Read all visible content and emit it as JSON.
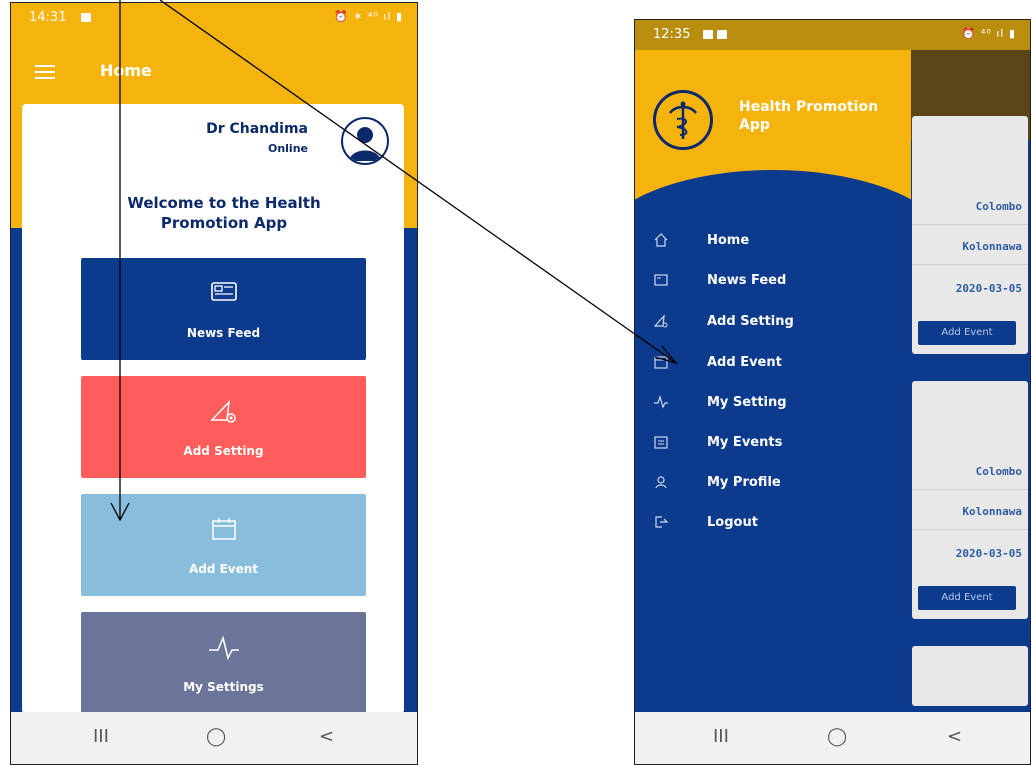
{
  "left_screen": {
    "status": {
      "time": "14:31",
      "sys_icons": "⏰ ✶ ⁴⁰ ıl ▮"
    },
    "header": {
      "title": "Home"
    },
    "user": {
      "name": "Dr Chandima",
      "status": "Online"
    },
    "welcome": "Welcome to the Health Promotion App",
    "tiles": [
      {
        "label": "News Feed",
        "icon": "newspaper-icon",
        "color": "#0c3a8c"
      },
      {
        "label": "Add Setting",
        "icon": "settings-plane-icon",
        "color": "#ff5c5c"
      },
      {
        "label": "Add Event",
        "icon": "calendar-icon",
        "color": "#88bddb"
      },
      {
        "label": "My Settings",
        "icon": "pulse-icon",
        "color": "#6b7499"
      }
    ],
    "nav": {
      "recents": "III",
      "home": "◯",
      "back": "<"
    }
  },
  "right_screen": {
    "status": {
      "time": "12:35",
      "sys_icons": "⏰ ⁴⁰ ıl ▮"
    },
    "drawer": {
      "app_title": "Health Promotion App",
      "items": [
        {
          "label": "Home",
          "icon": "home-icon"
        },
        {
          "label": "News Feed",
          "icon": "newspaper-icon"
        },
        {
          "label": "Add Setting",
          "icon": "settings-plane-icon"
        },
        {
          "label": "Add Event",
          "icon": "calendar-icon"
        },
        {
          "label": "My Setting",
          "icon": "pulse-icon"
        },
        {
          "label": "My Events",
          "icon": "calendar-grid-icon"
        },
        {
          "label": "My Profile",
          "icon": "person-icon"
        },
        {
          "label": "Logout",
          "icon": "logout-icon"
        }
      ]
    },
    "events": [
      {
        "district": "Colombo",
        "area": "Kolonnawa",
        "date": "2020-03-05",
        "button": "Add Event"
      },
      {
        "district": "Colombo",
        "area": "Kolonnawa",
        "date": "2020-03-05",
        "button": "Add Event"
      }
    ],
    "nav": {
      "recents": "III",
      "home": "◯",
      "back": "<"
    }
  },
  "colors": {
    "yellow": "#f5b40d",
    "navy": "#0c3a8c",
    "coral": "#ff5c5c",
    "light_blue": "#88bddb",
    "slate": "#6b7499"
  }
}
